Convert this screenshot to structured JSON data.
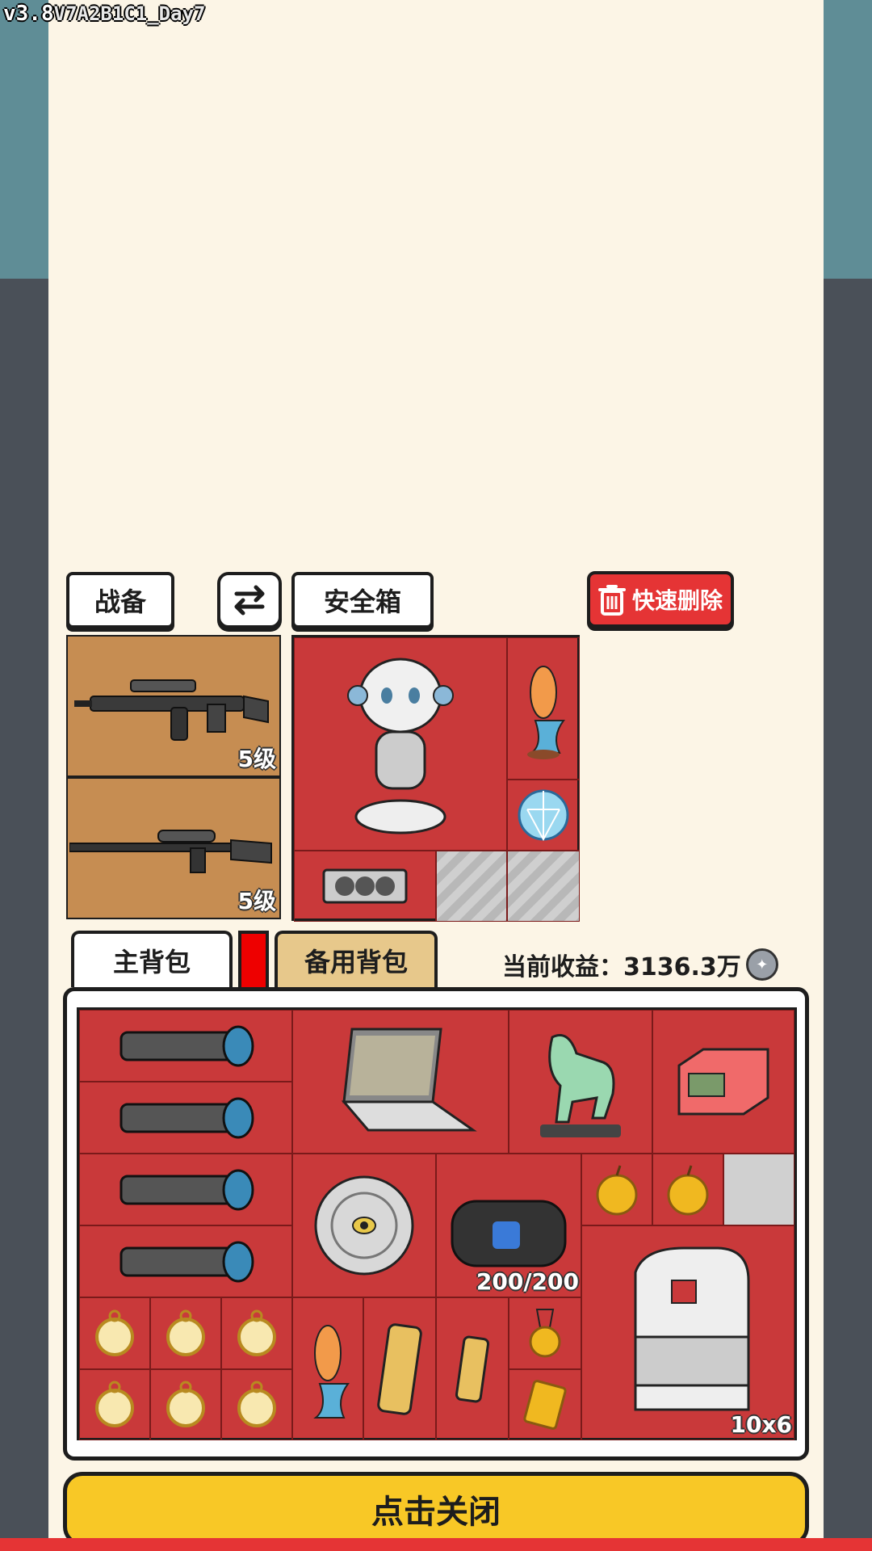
{
  "version": {
    "main": "v3.8",
    "sub": "V7A2B1C1_Day7"
  },
  "buttons": {
    "gear": "战备",
    "swap_icon": "swap-arrows-icon",
    "safebox": "安全箱",
    "quick_delete": "快速删除",
    "close": "点击关闭"
  },
  "weapons": [
    {
      "icon": "assault-rifle-icon",
      "level": "5级"
    },
    {
      "icon": "sniper-rifle-icon",
      "level": "5级"
    }
  ],
  "safebox_items": [
    "robot-figure-icon",
    "koi-fish-statue-icon",
    "diamond-icon",
    "graphics-card-icon"
  ],
  "tabs": {
    "main_bag": "主背包",
    "backup_bag": "备用背包"
  },
  "earnings": {
    "label": "当前收益：3136.3万"
  },
  "bag": {
    "capacity_label": "200/200",
    "size_label": "10x6",
    "items": [
      "camera-lens-icon",
      "laptop-icon",
      "jade-horse-statue-icon",
      "red-device-icon",
      "ornate-plate-icon",
      "duffel-bag-icon",
      "golden-apple-icon",
      "backpack-icon",
      "pocket-watch-icon",
      "koi-fish-statue-icon",
      "gold-bar-icon",
      "medal-icon",
      "gold-card-icon"
    ]
  },
  "colors": {
    "grid_red": "#c9393a",
    "weapon_tan": "#c68d52",
    "close_yellow": "#f8c826",
    "delete_red": "#e53435"
  }
}
